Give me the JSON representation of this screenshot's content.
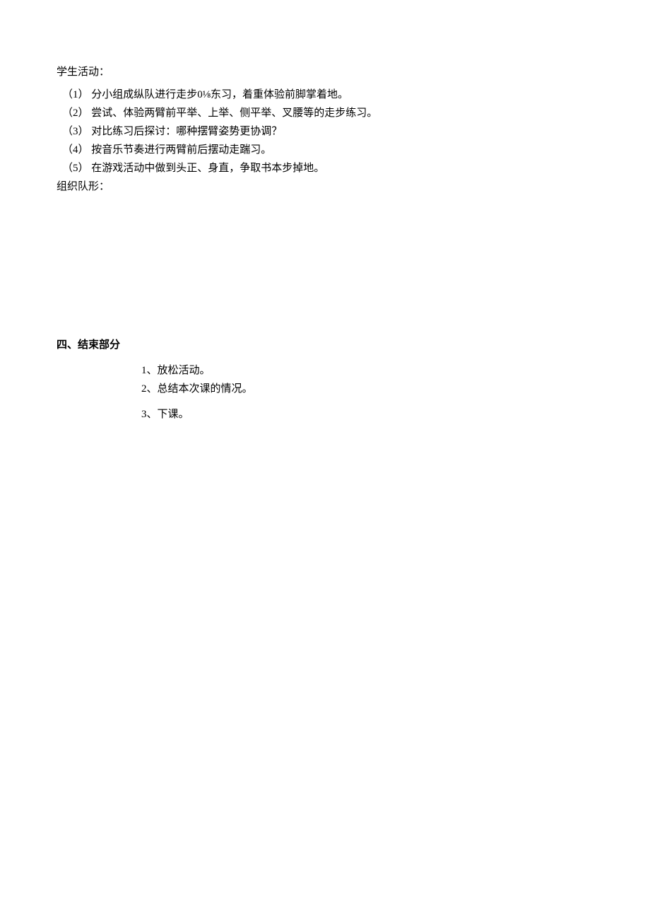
{
  "student_activities": {
    "heading": "学生活动：",
    "items": [
      {
        "num": "（1）",
        "text": "分小组成纵队进行走步0⅛东习，着重体验前脚掌着地。"
      },
      {
        "num": "（2）",
        "text": "尝试、体验两臂前平举、上举、侧平举、叉腰等的走步练习。"
      },
      {
        "num": "（3）",
        "text": "对比练习后探讨：哪种摆臂姿势更协调？"
      },
      {
        "num": "（4）",
        "text": "按音乐节奏进行两臂前后摆动走踹习。"
      },
      {
        "num": "（5）",
        "text": "在游戏活动中做到头正、身直，争取书本步掉地。"
      }
    ],
    "formation_label": "组织队形："
  },
  "section_four": {
    "heading": "四、结束部分",
    "items": [
      {
        "num": "1",
        "sep": "、",
        "text": "放松活动。"
      },
      {
        "num": "2",
        "sep": "、",
        "text": "总结本次课的情况。"
      },
      {
        "num": "3",
        "sep": "、",
        "text": "下课。"
      }
    ]
  }
}
